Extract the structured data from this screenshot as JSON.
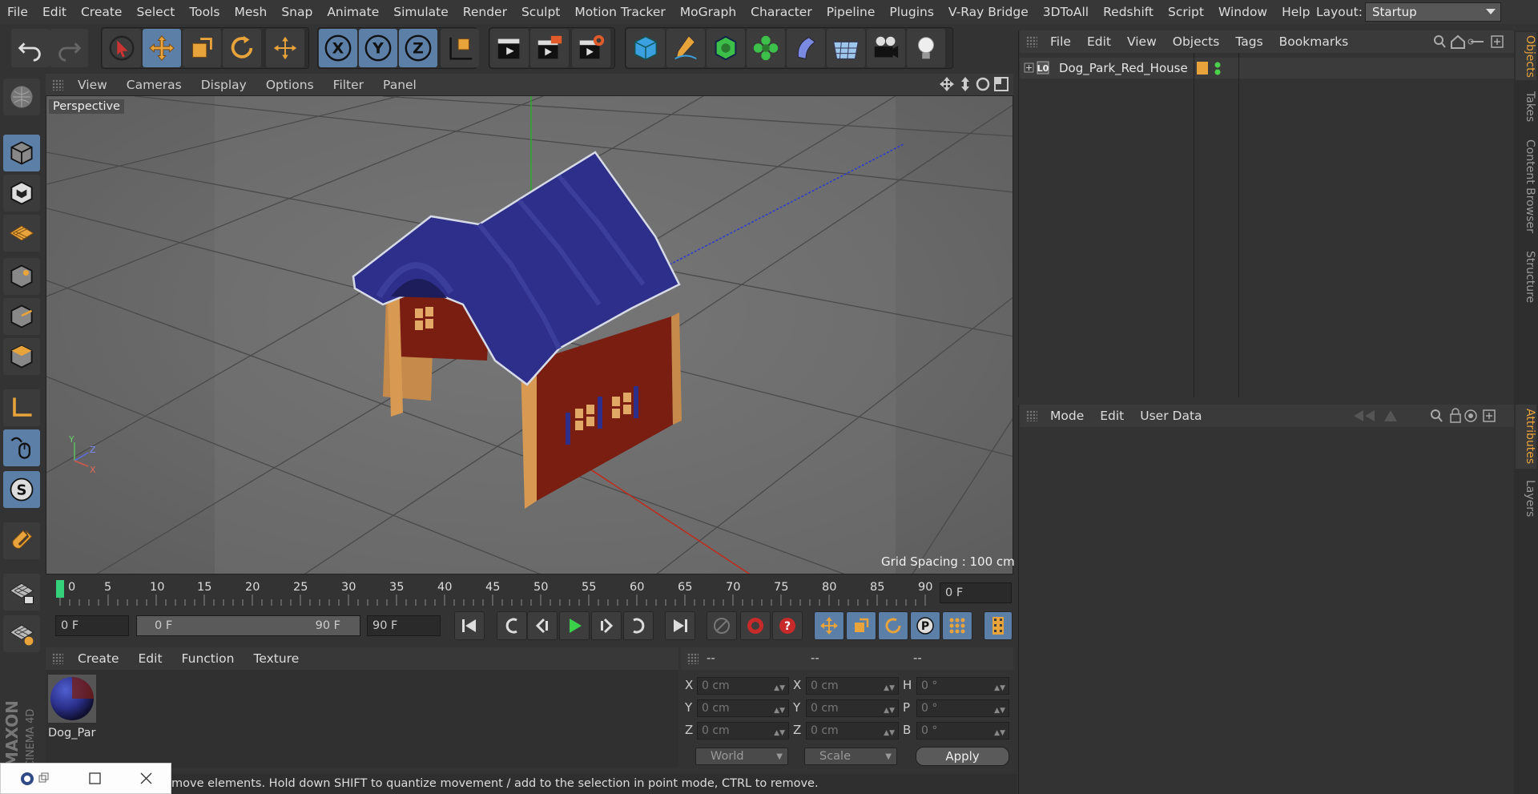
{
  "menubar": {
    "items": [
      "File",
      "Edit",
      "Create",
      "Select",
      "Tools",
      "Mesh",
      "Snap",
      "Animate",
      "Simulate",
      "Render",
      "Sculpt",
      "Motion Tracker",
      "MoGraph",
      "Character",
      "Pipeline",
      "Plugins",
      "V-Ray Bridge",
      "3DToAll",
      "Redshift",
      "Script",
      "Window",
      "Help"
    ],
    "layout_label": "Layout:",
    "layout_value": "Startup"
  },
  "viewport": {
    "menu": [
      "View",
      "Cameras",
      "Display",
      "Options",
      "Filter",
      "Panel"
    ],
    "camera_label": "Perspective",
    "grid_spacing": "Grid Spacing : 100 cm",
    "axis_labels": {
      "y": "Y",
      "z": "Z",
      "x": "X"
    }
  },
  "timeline": {
    "ticks": [
      "0",
      "5",
      "10",
      "15",
      "20",
      "25",
      "30",
      "35",
      "40",
      "45",
      "50",
      "55",
      "60",
      "65",
      "70",
      "75",
      "80",
      "85",
      "90"
    ],
    "current_frame": "0 F",
    "start_frame": "0 F",
    "range_start": "0 F",
    "range_end": "90 F",
    "end_frame": "90 F"
  },
  "material_manager": {
    "menu": [
      "Create",
      "Edit",
      "Function",
      "Texture"
    ],
    "material_name": "Dog_Par"
  },
  "coordinates": {
    "headers": [
      "--",
      "--",
      "--"
    ],
    "rows": [
      {
        "l1": "X",
        "v1": "0 cm",
        "l2": "X",
        "v2": "0 cm",
        "l3": "H",
        "v3": "0 °"
      },
      {
        "l1": "Y",
        "v1": "0 cm",
        "l2": "Y",
        "v2": "0 cm",
        "l3": "P",
        "v3": "0 °"
      },
      {
        "l1": "Z",
        "v1": "0 cm",
        "l2": "Z",
        "v2": "0 cm",
        "l3": "B",
        "v3": "0 °"
      }
    ],
    "space": "World",
    "mode": "Scale",
    "apply": "Apply"
  },
  "object_manager": {
    "menu": [
      "File",
      "Edit",
      "View",
      "Objects",
      "Tags",
      "Bookmarks"
    ],
    "object_name": "Dog_Park_Red_House"
  },
  "attribute_manager": {
    "menu": [
      "Mode",
      "Edit",
      "User Data"
    ]
  },
  "side_tabs": [
    "Objects",
    "Takes",
    "Content Browser",
    "Structure",
    "Attributes",
    "Layers"
  ],
  "status": "move elements. Hold down SHIFT to quantize movement / add to the selection in point mode, CTRL to remove.",
  "branding": "MAXON CINEMA 4D",
  "colors": {
    "accent": "#5c7fa8",
    "roof": "#2e2f8a",
    "wall": "#7a1e12",
    "wood": "#c68a4a",
    "orange_icon": "#e8a33a"
  }
}
